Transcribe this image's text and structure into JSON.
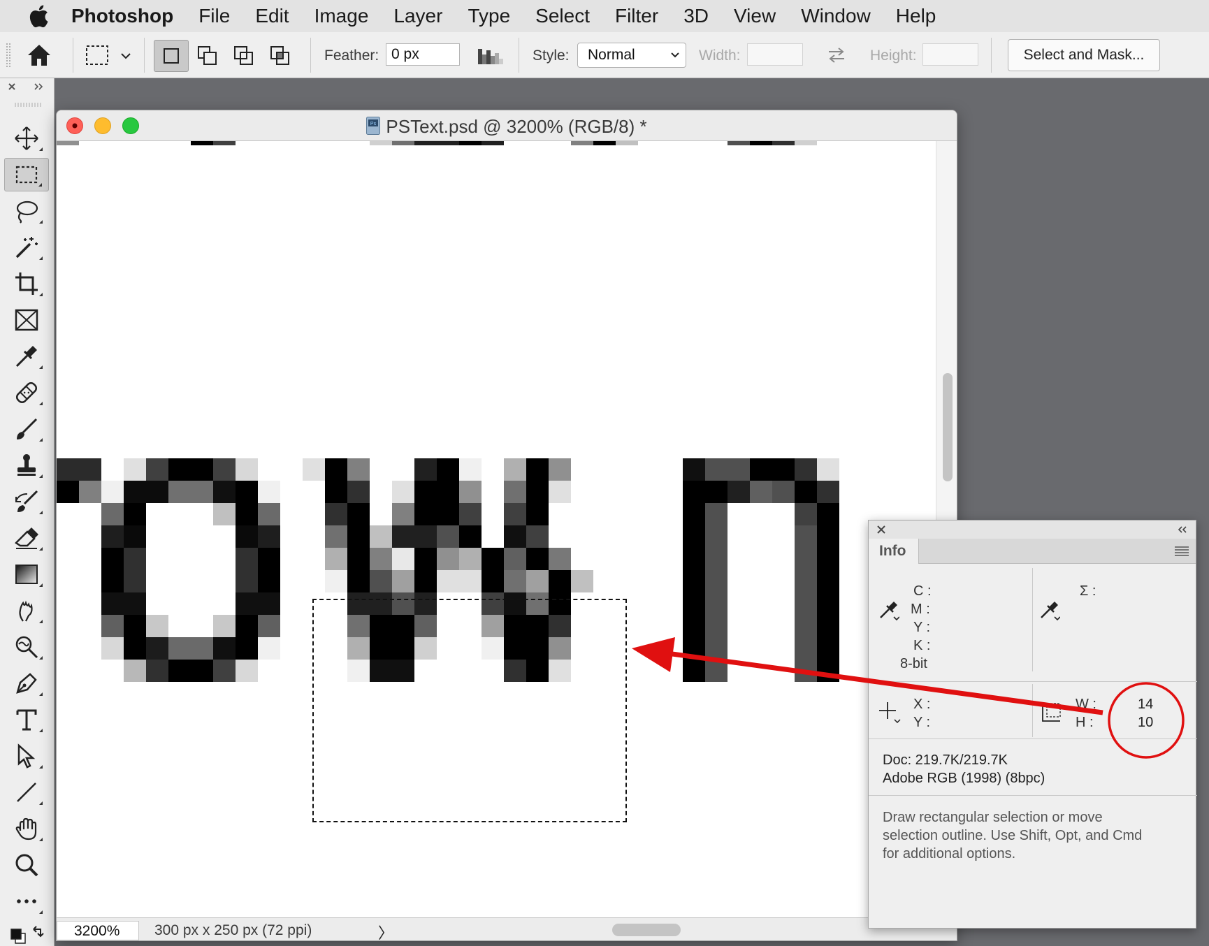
{
  "menubar": {
    "apple_icon": "apple-logo-icon",
    "items": [
      "Photoshop",
      "File",
      "Edit",
      "Image",
      "Layer",
      "Type",
      "Select",
      "Filter",
      "3D",
      "View",
      "Window",
      "Help"
    ]
  },
  "options": {
    "feather_label": "Feather:",
    "feather_value": "0 px",
    "style_label": "Style:",
    "style_value": "Normal",
    "width_label": "Width:",
    "width_value": "",
    "height_label": "Height:",
    "height_value": "",
    "select_mask_label": "Select and Mask..."
  },
  "tools": [
    "move",
    "rectangular-marquee",
    "lasso",
    "magic-wand",
    "crop",
    "frame",
    "eyedropper",
    "healing-brush",
    "brush",
    "clone-stamp",
    "history-brush",
    "eraser",
    "gradient",
    "smudge",
    "dodge",
    "pen",
    "type",
    "path-selection",
    "line",
    "hand",
    "zoom",
    "more"
  ],
  "document": {
    "title": "PSText.psd @ 3200% (RGB/8) *",
    "zoom": "3200%",
    "doc_size": "300 px x 250 px (72 ppi)",
    "status_arrow": "〉"
  },
  "canvas": {
    "pixel_size": 32,
    "selection": {
      "width": 14,
      "height": 10
    },
    "glyph_rows": [
      {
        "x": 0,
        "y": 0,
        "cells": [
          "2b",
          "2b"
        ]
      },
      {
        "x": 0,
        "y": 1,
        "cells": [
          "00",
          "80"
        ]
      },
      {
        "x": 3,
        "y": 0,
        "cells": [
          "e0",
          "40",
          "00",
          "00",
          "40",
          "d8"
        ]
      },
      {
        "x": 2,
        "y": 1,
        "cells": [
          "f0",
          "0c",
          "0c",
          "70",
          "70",
          "10",
          "00",
          "f0"
        ]
      },
      {
        "x": 2,
        "y": 2,
        "cells": [
          "6a",
          "00",
          "ff",
          "ff",
          "ff",
          "c0",
          "00",
          "6a"
        ]
      },
      {
        "x": 2,
        "y": 3,
        "cells": [
          "1e",
          "0a",
          "ff",
          "ff",
          "ff",
          "ff",
          "0a",
          "1e"
        ]
      },
      {
        "x": 2,
        "y": 4,
        "cells": [
          "00",
          "30",
          "ff",
          "ff",
          "ff",
          "ff",
          "30",
          "00"
        ]
      },
      {
        "x": 2,
        "y": 5,
        "cells": [
          "00",
          "30",
          "ff",
          "ff",
          "ff",
          "ff",
          "30",
          "00"
        ]
      },
      {
        "x": 2,
        "y": 6,
        "cells": [
          "10",
          "10",
          "ff",
          "ff",
          "ff",
          "ff",
          "10",
          "10"
        ]
      },
      {
        "x": 2,
        "y": 7,
        "cells": [
          "60",
          "00",
          "c8",
          "ff",
          "ff",
          "c8",
          "00",
          "60"
        ]
      },
      {
        "x": 2,
        "y": 8,
        "cells": [
          "d8",
          "00",
          "1c",
          "6a",
          "6a",
          "10",
          "00",
          "f0"
        ]
      },
      {
        "x": 3,
        "y": 9,
        "cells": [
          "b8",
          "30",
          "00",
          "00",
          "40",
          "d8"
        ]
      },
      {
        "x": 11,
        "y": 0,
        "cells": [
          "e0",
          "00",
          "80",
          "ff",
          "ff",
          "20",
          "00",
          "f0",
          "ff",
          "b0",
          "00",
          "90"
        ]
      },
      {
        "x": 11,
        "y": 1,
        "cells": [
          "ff",
          "00",
          "30",
          "ff",
          "e0",
          "00",
          "00",
          "90",
          "ff",
          "70",
          "00",
          "e0"
        ]
      },
      {
        "x": 11,
        "y": 2,
        "cells": [
          "ff",
          "30",
          "00",
          "ff",
          "80",
          "00",
          "00",
          "40",
          "ff",
          "40",
          "00",
          "ff"
        ]
      },
      {
        "x": 11,
        "y": 3,
        "cells": [
          "ff",
          "70",
          "00",
          "c0",
          "20",
          "20",
          "50",
          "00",
          "ff",
          "10",
          "40",
          "ff"
        ]
      },
      {
        "x": 11,
        "y": 4,
        "cells": [
          "ff",
          "b0",
          "00",
          "80",
          "e8",
          "00",
          "90",
          "b0",
          "00",
          "60",
          "00",
          "78"
        ]
      },
      {
        "x": 11,
        "y": 5,
        "cells": [
          "ff",
          "f0",
          "00",
          "50",
          "a0",
          "00",
          "e0",
          "e0",
          "00",
          "70",
          "a0",
          "00",
          "c0"
        ]
      },
      {
        "x": 11,
        "y": 6,
        "cells": [
          "ff",
          "ff",
          "20",
          "20",
          "50",
          "20",
          "ff",
          "ff",
          "40",
          "10",
          "70",
          "00",
          "ff"
        ]
      },
      {
        "x": 11,
        "y": 7,
        "cells": [
          "ff",
          "ff",
          "70",
          "00",
          "00",
          "60",
          "ff",
          "ff",
          "a0",
          "00",
          "00",
          "30",
          "ff"
        ]
      },
      {
        "x": 11,
        "y": 8,
        "cells": [
          "ff",
          "ff",
          "b0",
          "00",
          "00",
          "d0",
          "ff",
          "ff",
          "f0",
          "00",
          "00",
          "90",
          "ff"
        ]
      },
      {
        "x": 11,
        "y": 9,
        "cells": [
          "ff",
          "ff",
          "f0",
          "10",
          "10",
          "ff",
          "ff",
          "ff",
          "ff",
          "30",
          "00",
          "e0",
          "ff"
        ]
      },
      {
        "x": 28,
        "y": 0,
        "cells": [
          "10",
          "50",
          "50",
          "00",
          "00",
          "30",
          "e0"
        ]
      },
      {
        "x": 28,
        "y": 1,
        "cells": [
          "00",
          "00",
          "20",
          "60",
          "50",
          "00",
          "30"
        ]
      },
      {
        "x": 28,
        "y": 2,
        "cells": [
          "00",
          "50",
          "ff",
          "ff",
          "ff",
          "40",
          "00"
        ]
      },
      {
        "x": 28,
        "y": 3,
        "cells": [
          "00",
          "50",
          "ff",
          "ff",
          "ff",
          "50",
          "00"
        ]
      },
      {
        "x": 28,
        "y": 4,
        "cells": [
          "00",
          "50",
          "ff",
          "ff",
          "ff",
          "50",
          "00"
        ]
      },
      {
        "x": 28,
        "y": 5,
        "cells": [
          "00",
          "50",
          "ff",
          "ff",
          "ff",
          "50",
          "00"
        ]
      },
      {
        "x": 28,
        "y": 6,
        "cells": [
          "00",
          "50",
          "ff",
          "ff",
          "ff",
          "50",
          "00"
        ]
      },
      {
        "x": 28,
        "y": 7,
        "cells": [
          "00",
          "50",
          "ff",
          "ff",
          "ff",
          "50",
          "00"
        ]
      },
      {
        "x": 28,
        "y": 8,
        "cells": [
          "00",
          "50",
          "ff",
          "ff",
          "ff",
          "50",
          "00"
        ]
      },
      {
        "x": 28,
        "y": 9,
        "cells": [
          "00",
          "50",
          "ff",
          "ff",
          "ff",
          "50",
          "00"
        ]
      }
    ],
    "top_strip": [
      {
        "x": 0,
        "cells": [
          "90"
        ]
      },
      {
        "x": 6,
        "cells": [
          "00",
          "40"
        ]
      },
      {
        "x": 14,
        "cells": [
          "d0",
          "70",
          "20",
          "20",
          "00",
          "20"
        ]
      },
      {
        "x": 23,
        "cells": [
          "80",
          "00",
          "c0"
        ]
      },
      {
        "x": 30,
        "cells": [
          "50",
          "00",
          "30",
          "d0"
        ]
      }
    ]
  },
  "info_panel": {
    "tab": "Info",
    "cmyk_labels": [
      "C :",
      "M :",
      "Y :",
      "K :"
    ],
    "bit_depth": "8-bit",
    "sigma_label": "Σ :",
    "xy_labels": [
      "X :",
      "Y :"
    ],
    "wh_labels": [
      "W :",
      "H :"
    ],
    "w_value": "14",
    "h_value": "10",
    "doc_size": "Doc: 219.7K/219.7K",
    "profile": "Adobe RGB (1998) (8bpc)",
    "hint_lines": [
      "Draw rectangular selection or move",
      "selection outline.  Use Shift, Opt, and Cmd",
      "for additional options."
    ]
  },
  "annotation": {
    "color": "#e01010"
  },
  "colors": {
    "traffic_close": "#fe5f57",
    "traffic_min": "#febc2e",
    "traffic_max": "#28c840"
  }
}
